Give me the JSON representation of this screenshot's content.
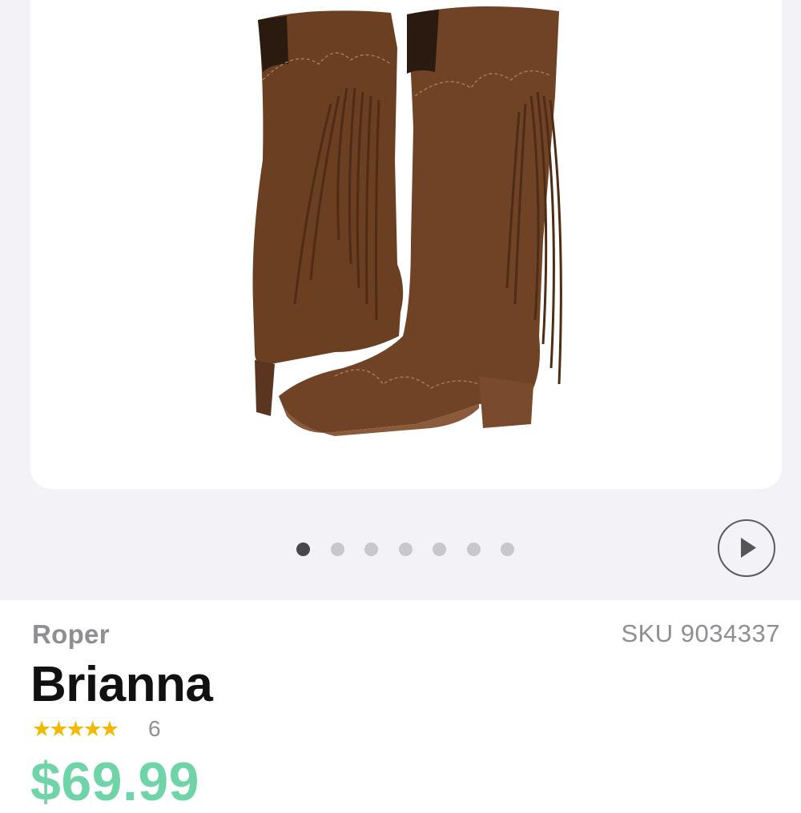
{
  "gallery": {
    "image_alt": "product-boots-photo",
    "slide_count": 7,
    "active_slide": 1,
    "play_icon": "play-icon"
  },
  "product": {
    "brand": "Roper",
    "sku": "SKU 9034337",
    "name": "Brianna",
    "rating": 5,
    "stars": "★★★★★",
    "review_count": "6",
    "price": "$69.99"
  },
  "colors": {
    "price_green": "#6fd4a8",
    "star_gold": "#f5b800",
    "gray_text": "#8e8e93",
    "boot_brown": "#6b4024"
  }
}
